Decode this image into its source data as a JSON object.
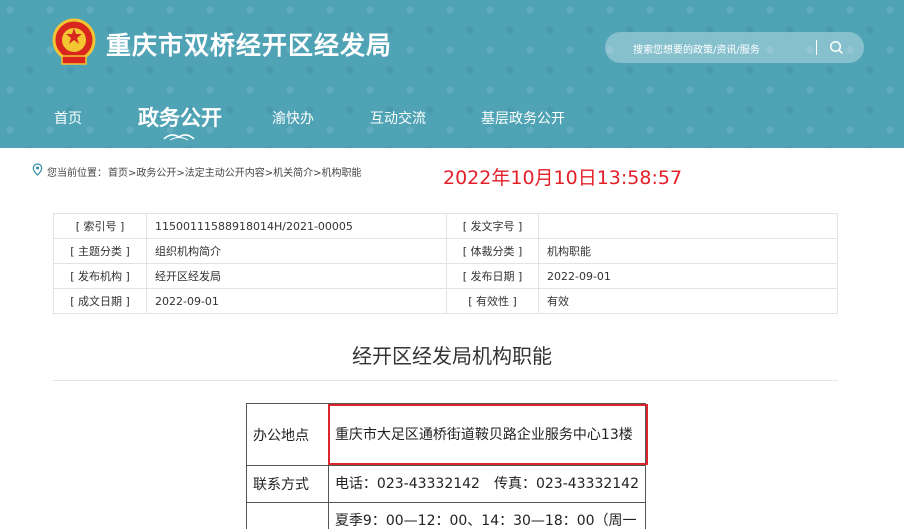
{
  "header": {
    "site_title": "重庆市双桥经开区经发局",
    "search_placeholder": "搜索您想要的政策/资讯/服务"
  },
  "nav": [
    {
      "label": "首页"
    },
    {
      "label": "政务公开"
    },
    {
      "label": "渝快办"
    },
    {
      "label": "互动交流"
    },
    {
      "label": "基层政务公开"
    }
  ],
  "breadcrumb": {
    "label": "您当前位置：",
    "path": "首页>政务公开>法定主动公开内容>机关简介>机构职能"
  },
  "timestamp": "2022年10月10日13:58:57",
  "info_table": {
    "rows": [
      {
        "l1": "[ 索引号 ]",
        "v1": "11500111588918014H/2021-00005",
        "l2": "[ 发文字号 ]",
        "v2": ""
      },
      {
        "l1": "[ 主题分类 ]",
        "v1": "组织机构简介",
        "l2": "[ 体裁分类 ]",
        "v2": "机构职能"
      },
      {
        "l1": "[ 发布机构 ]",
        "v1": "经开区经发局",
        "l2": "[ 发布日期 ]",
        "v2": "2022-09-01"
      },
      {
        "l1": "[ 成文日期 ]",
        "v1": "2022-09-01",
        "l2": "[ 有效性 ]",
        "v2": "有效"
      }
    ]
  },
  "doc_title": "经开区经发局机构职能",
  "content_table": {
    "rows": [
      {
        "label": "办公地点",
        "value": "重庆市大足区通桥街道鞍贝路企业服务中心13楼"
      },
      {
        "label": "联系方式",
        "value": "电话：023-43332142　传真：023-43332142"
      },
      {
        "label": "",
        "value": "夏季9：00—12：00、14：30—18：00（周一"
      }
    ]
  },
  "colors": {
    "header_bg": "#4fa3b5",
    "timestamp": "#e3202a",
    "highlight": "#d9262f"
  }
}
